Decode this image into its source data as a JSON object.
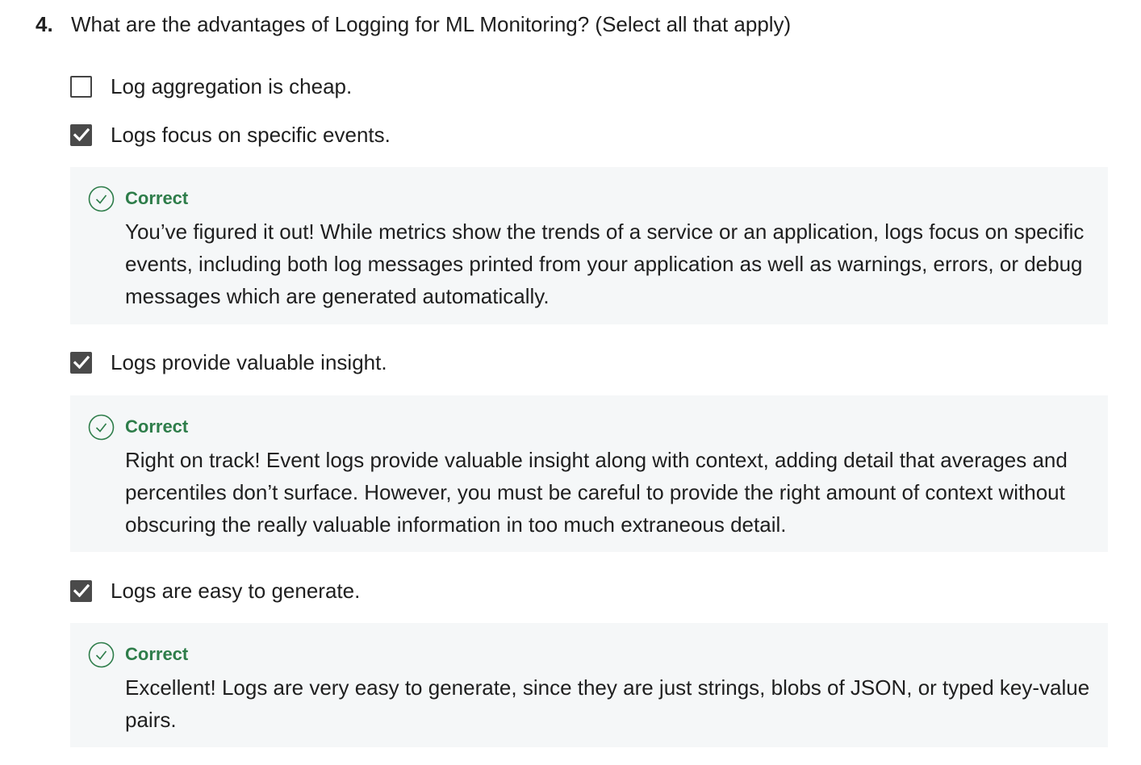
{
  "question": {
    "number": "4.",
    "text": "What are the advantages of Logging for ML Monitoring? (Select all that apply)"
  },
  "options": [
    {
      "label": "Log aggregation is cheap.",
      "checked": false
    },
    {
      "label": "Logs focus on specific events.",
      "checked": true,
      "feedback": {
        "status": "Correct",
        "text": "You’ve figured it out! While metrics show the trends of a service or an application, logs focus on specific events, including both log messages printed from your application as well as warnings, errors, or debug messages which are generated automatically."
      }
    },
    {
      "label": "Logs provide valuable insight.",
      "checked": true,
      "feedback": {
        "status": "Correct",
        "text": "Right on track! Event logs provide valuable insight along with context, adding detail that averages and percentiles don’t surface. However, you must be careful to provide the right amount of context without obscuring the really valuable information in too much extraneous detail."
      }
    },
    {
      "label": "Logs are easy to generate.",
      "checked": true,
      "feedback": {
        "status": "Correct",
        "text": "Excellent! Logs are very easy to generate, since they are just strings, blobs of JSON, or typed key-value pairs."
      }
    }
  ],
  "colors": {
    "correct": "#2e7d4a",
    "feedback_bg": "#f5f7f8",
    "checkbox_checked": "#4a4a4a"
  },
  "icons": {
    "checkmark": "check-icon",
    "correct": "correct-circle-check-icon"
  }
}
